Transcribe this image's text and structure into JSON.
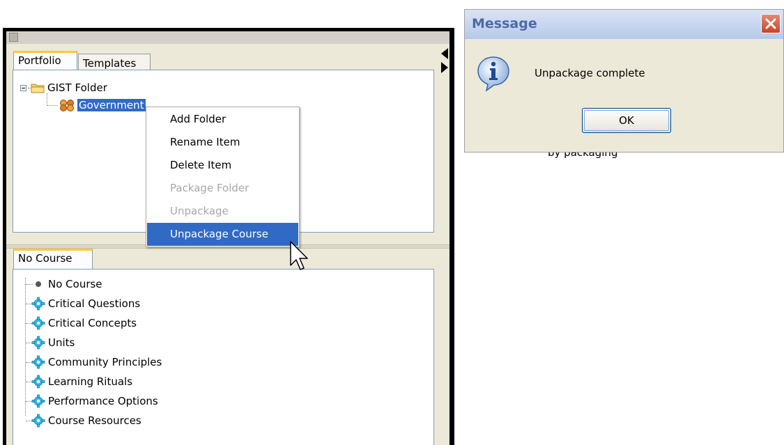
{
  "portfolio_panel": {
    "tabs": [
      {
        "label": "Portfolio",
        "active": true
      },
      {
        "label": "Templates",
        "active": false
      }
    ],
    "tree": {
      "root": {
        "label": "GIST Folder",
        "icon": "folder-icon",
        "expanded": true
      },
      "child": {
        "label": "Government",
        "icon": "course-package-icon",
        "selected": true
      }
    }
  },
  "context_menu": {
    "items": [
      {
        "label": "Add Folder",
        "enabled": true,
        "highlighted": false
      },
      {
        "label": "Rename Item",
        "enabled": true,
        "highlighted": false
      },
      {
        "label": "Delete Item",
        "enabled": true,
        "highlighted": false
      },
      {
        "label": "Package Folder",
        "enabled": false,
        "highlighted": false
      },
      {
        "label": "Unpackage",
        "enabled": false,
        "highlighted": false
      },
      {
        "label": "Unpackage Course",
        "enabled": true,
        "highlighted": true
      }
    ]
  },
  "course_panel": {
    "tab": {
      "label": "No Course"
    },
    "items": [
      {
        "label": "No Course",
        "icon": "bullet-icon"
      },
      {
        "label": "Critical Questions",
        "icon": "gear-icon"
      },
      {
        "label": "Critical Concepts",
        "icon": "gear-icon"
      },
      {
        "label": "Units",
        "icon": "gear-icon"
      },
      {
        "label": "Community Principles",
        "icon": "gear-icon"
      },
      {
        "label": "Learning Rituals",
        "icon": "gear-icon"
      },
      {
        "label": "Performance Options",
        "icon": "gear-icon"
      },
      {
        "label": "Course Resources",
        "icon": "gear-icon"
      }
    ]
  },
  "dialog": {
    "title": "Message",
    "message": "Unpackage complete",
    "ok_label": "OK",
    "icon": "info-icon"
  },
  "background_fragment": "by packaging",
  "colors": {
    "selection": "#316ac5",
    "window_bg": "#ece9d8",
    "tab_accent": "#ffc83c",
    "disabled_text": "#a7a6aa",
    "gear": "#2fb8e6"
  }
}
